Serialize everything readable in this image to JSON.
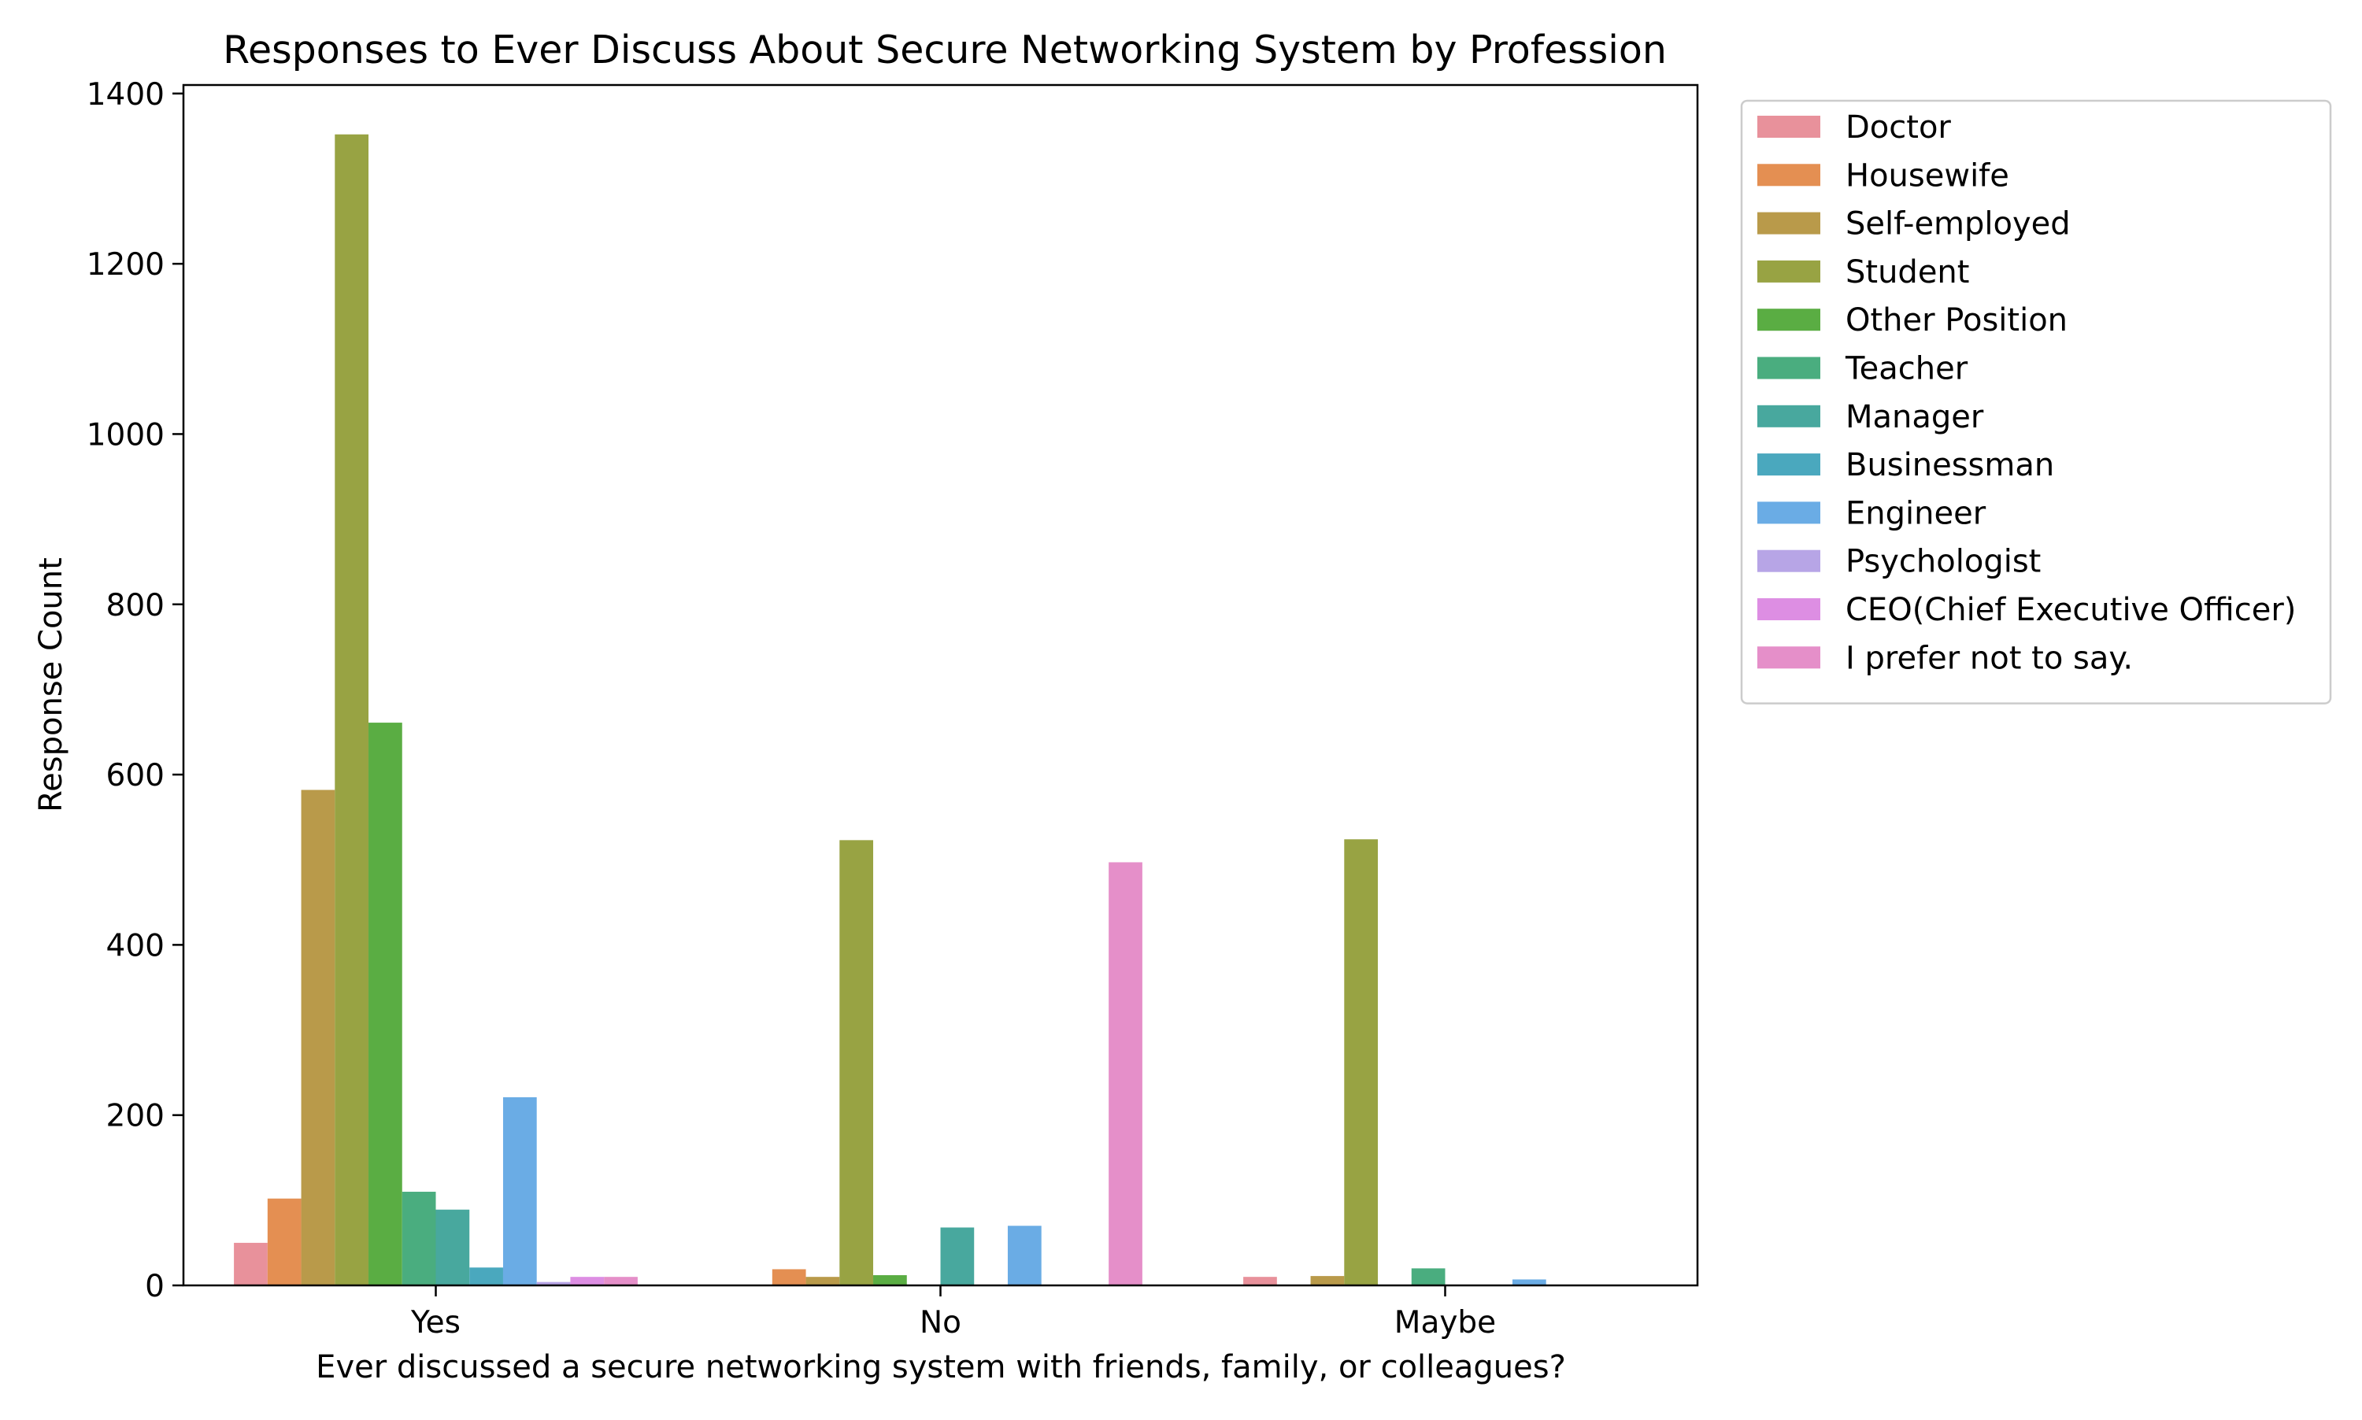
{
  "chart_data": {
    "type": "bar",
    "title": "Responses to Ever Discuss About Secure Networking System by Profession",
    "xlabel": "Ever discussed a secure networking system with friends, family, or colleagues?",
    "ylabel": "Response Count",
    "categories": [
      "Yes",
      "No",
      "Maybe"
    ],
    "ylim": [
      0,
      1410
    ],
    "yticks": [
      0,
      200,
      400,
      600,
      800,
      1000,
      1200,
      1400
    ],
    "ytick_labels": [
      "0",
      "200",
      "400",
      "600",
      "800",
      "1000",
      "1200",
      "1400"
    ],
    "grid": false,
    "legend_position": "outside-right",
    "series": [
      {
        "name": "Doctor",
        "color": "#e8919b",
        "values": [
          50,
          0,
          10
        ]
      },
      {
        "name": "Housewife",
        "color": "#e48f52",
        "values": [
          102,
          19,
          0
        ]
      },
      {
        "name": "Self-employed",
        "color": "#b99a4a",
        "values": [
          582,
          10,
          11
        ]
      },
      {
        "name": "Student",
        "color": "#98a343",
        "values": [
          1352,
          523,
          524
        ]
      },
      {
        "name": "Other Position",
        "color": "#5aad43",
        "values": [
          661,
          12,
          0
        ]
      },
      {
        "name": "Teacher",
        "color": "#4aad7f",
        "values": [
          110,
          0,
          20
        ]
      },
      {
        "name": "Manager",
        "color": "#48a89e",
        "values": [
          89,
          68,
          0
        ]
      },
      {
        "name": "Businessman",
        "color": "#4aa8be",
        "values": [
          21,
          0,
          0
        ]
      },
      {
        "name": "Engineer",
        "color": "#6aace5",
        "values": [
          221,
          70,
          7
        ]
      },
      {
        "name": "Psychologist",
        "color": "#b7a5e6",
        "values": [
          4,
          0,
          0
        ]
      },
      {
        "name": "CEO(Chief Executive Officer)",
        "color": "#dd8ee3",
        "values": [
          10,
          0,
          0
        ]
      },
      {
        "name": "I prefer not to say.",
        "color": "#e58fc9",
        "values": [
          10,
          497,
          0
        ]
      }
    ]
  }
}
